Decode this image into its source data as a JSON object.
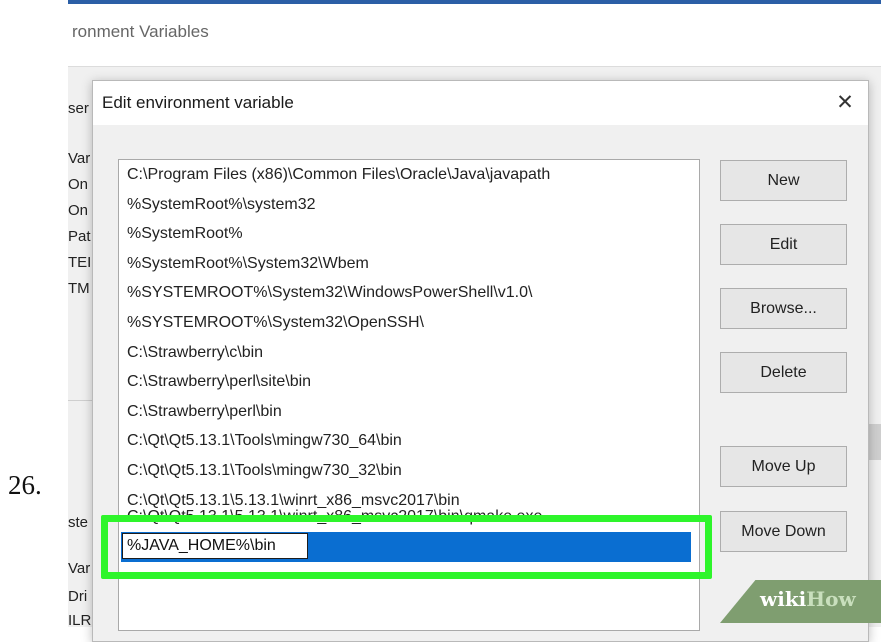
{
  "step_number": "26.",
  "background_window": {
    "title": "ronment Variables",
    "peek_labels_top": [
      "ser",
      "Var",
      "On",
      "On",
      "Pat",
      "TEI",
      "TM"
    ],
    "peek_labels_bottom": [
      "ste",
      "Var",
      "Dri",
      "ILR"
    ]
  },
  "dialog": {
    "title": "Edit environment variable",
    "close_glyph": "✕",
    "paths": [
      "C:\\Program Files (x86)\\Common Files\\Oracle\\Java\\javapath",
      "%SystemRoot%\\system32",
      "%SystemRoot%",
      "%SystemRoot%\\System32\\Wbem",
      "%SYSTEMROOT%\\System32\\WindowsPowerShell\\v1.0\\",
      "%SYSTEMROOT%\\System32\\OpenSSH\\",
      "C:\\Strawberry\\c\\bin",
      "C:\\Strawberry\\perl\\site\\bin",
      "C:\\Strawberry\\perl\\bin",
      "C:\\Qt\\Qt5.13.1\\Tools\\mingw730_64\\bin",
      "C:\\Qt\\Qt5.13.1\\Tools\\mingw730_32\\bin",
      "C:\\Qt\\Qt5.13.1\\5.13.1\\winrt_x86_msvc2017\\bin"
    ],
    "partial_path": "C:\\Qt\\Qt5.13.1\\5.13.1\\winrt_x86_msvc2017\\bin\\qmake.exe",
    "editing_value": "%JAVA_HOME%\\bin",
    "buttons": {
      "new": "New",
      "edit": "Edit",
      "browse": "Browse...",
      "delete": "Delete",
      "move_up": "Move Up",
      "move_down": "Move Down"
    }
  },
  "watermark": {
    "part1": "wiki",
    "part2": "How"
  },
  "colors": {
    "highlight": "#2ef52b",
    "selection": "#0a6ed1",
    "title_accent": "#2b5fa6"
  }
}
